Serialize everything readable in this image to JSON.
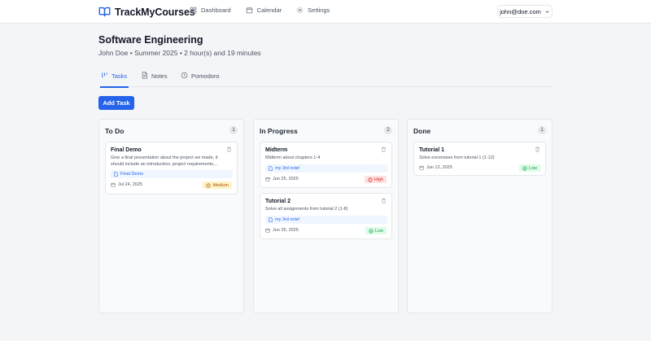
{
  "app": {
    "name": "TrackMyCourses"
  },
  "nav": {
    "items": [
      {
        "label": "Dashboard",
        "icon": "grid-icon"
      },
      {
        "label": "Calendar",
        "icon": "calendar-icon"
      },
      {
        "label": "Settings",
        "icon": "gear-icon"
      }
    ],
    "user_email": "john@doe.com"
  },
  "course": {
    "title": "Software Engineering",
    "subtitle": "John Doe • Summer 2025 • 2 hour(s) and 19 minutes"
  },
  "tabs": [
    {
      "label": "Tasks",
      "icon": "kanban-icon",
      "active": true
    },
    {
      "label": "Notes",
      "icon": "notes-icon",
      "active": false
    },
    {
      "label": "Pomodoro",
      "icon": "clock-icon",
      "active": false
    }
  ],
  "add_task_label": "Add Task",
  "columns": [
    {
      "title": "To Do",
      "count": "1",
      "cards": [
        {
          "title": "Final Demo",
          "description": "Give a final presentation about the project we made, it should include an introduction, project requirements,...",
          "note": "Final Demo",
          "date": "Jul 24, 2025",
          "priority": "Medium"
        }
      ]
    },
    {
      "title": "In Progress",
      "count": "2",
      "cards": [
        {
          "title": "Midterm",
          "description": "Midterm about chapters 1-4",
          "note": "my 3rd note!",
          "date": "Jun 25, 2025",
          "priority": "High"
        },
        {
          "title": "Tutorial 2",
          "description": "Solve all assignments from tutorial 2 (1-8)",
          "note": "my 3rd note!",
          "date": "Jun 26, 2025",
          "priority": "Low"
        }
      ]
    },
    {
      "title": "Done",
      "count": "1",
      "cards": [
        {
          "title": "Tutorial 1",
          "description": "Solve excersises from tutorial 1 (1-12)",
          "date": "Jun 12, 2025",
          "priority": "Low"
        }
      ]
    }
  ],
  "colors": {
    "accent": "#2563eb",
    "medium": "#b45309",
    "high": "#dc2626",
    "low": "#16a34a"
  }
}
